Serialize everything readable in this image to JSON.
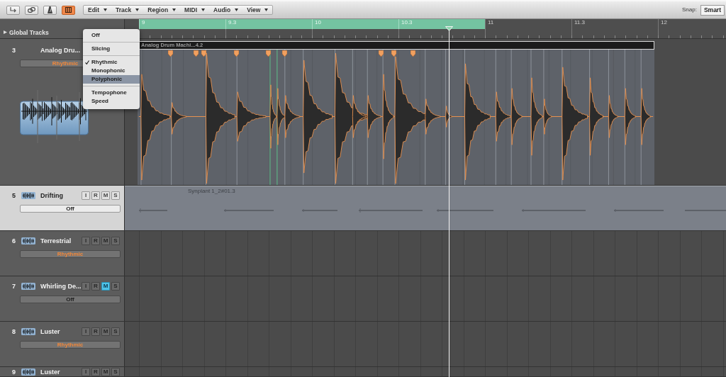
{
  "toolbar": {
    "tool_buttons": [
      {
        "selected": false
      },
      {
        "selected": false
      },
      {
        "selected": false
      },
      {
        "selected": true
      }
    ],
    "menus": [
      "Edit",
      "Track",
      "Region",
      "MIDI",
      "Audio",
      "View"
    ],
    "snap": {
      "label": "Snap:",
      "value": "Smart"
    }
  },
  "ruler": {
    "global_tracks": {
      "label": "Global Tracks",
      "expanded": false
    },
    "cycle_on": true,
    "cycle_bars": [
      "9",
      "9.3",
      "10",
      "10.3"
    ],
    "bars": [
      "11",
      "11.3",
      "12"
    ]
  },
  "tracks": [
    {
      "number": "3",
      "name": "Analog Dru...",
      "expanded": true,
      "selected": false,
      "flex_mode": {
        "value": "Rhythmic",
        "active": true
      },
      "region": {
        "kind": "flex",
        "name": "Analog Drum Machi...4.2"
      }
    },
    {
      "number": "5",
      "name": "Drifting",
      "expanded": false,
      "selected": true,
      "buttons": [
        {
          "label": "I",
          "on": false
        },
        {
          "label": "R",
          "on": false
        },
        {
          "label": "M",
          "on": false
        },
        {
          "label": "S",
          "on": false
        }
      ],
      "flex_mode": {
        "value": "Off",
        "active": false
      },
      "region": {
        "kind": "audio",
        "name": "Synplant 1_2#01.3"
      }
    },
    {
      "number": "6",
      "name": "Terrestrial",
      "expanded": false,
      "selected": false,
      "buttons": [
        {
          "label": "I",
          "on": false
        },
        {
          "label": "R",
          "on": false
        },
        {
          "label": "M",
          "on": false
        },
        {
          "label": "S",
          "on": false
        }
      ],
      "flex_mode": {
        "value": "Rhythmic",
        "active": true
      }
    },
    {
      "number": "7",
      "name": "Whirling De...",
      "expanded": false,
      "selected": false,
      "buttons": [
        {
          "label": "I",
          "on": false
        },
        {
          "label": "R",
          "on": false
        },
        {
          "label": "M",
          "on": true
        },
        {
          "label": "S",
          "on": false
        }
      ],
      "flex_mode": {
        "value": "Off",
        "active": false
      }
    },
    {
      "number": "8",
      "name": "Luster",
      "expanded": false,
      "selected": false,
      "buttons": [
        {
          "label": "I",
          "on": false
        },
        {
          "label": "R",
          "on": false
        },
        {
          "label": "M",
          "on": false
        },
        {
          "label": "S",
          "on": false
        }
      ],
      "flex_mode": {
        "value": "Rhythmic",
        "active": true
      }
    },
    {
      "number": "9",
      "name": "Luster",
      "expanded": false,
      "selected": false,
      "buttons": [
        {
          "label": "I",
          "on": false
        },
        {
          "label": "R",
          "on": false
        },
        {
          "label": "M",
          "on": false
        },
        {
          "label": "S",
          "on": false
        }
      ]
    }
  ],
  "flex_menu": {
    "sections": [
      [
        {
          "label": "Off",
          "checked": false,
          "highlighted": false
        }
      ],
      [
        {
          "label": "Slicing",
          "checked": false,
          "highlighted": false
        }
      ],
      [
        {
          "label": "Rhythmic",
          "checked": true,
          "highlighted": false
        },
        {
          "label": "Monophonic",
          "checked": false,
          "highlighted": false
        },
        {
          "label": "Polyphonic",
          "checked": false,
          "highlighted": true
        }
      ],
      [
        {
          "label": "Tempophone",
          "checked": false,
          "highlighted": false
        },
        {
          "label": "Speed",
          "checked": false,
          "highlighted": false
        }
      ]
    ]
  }
}
